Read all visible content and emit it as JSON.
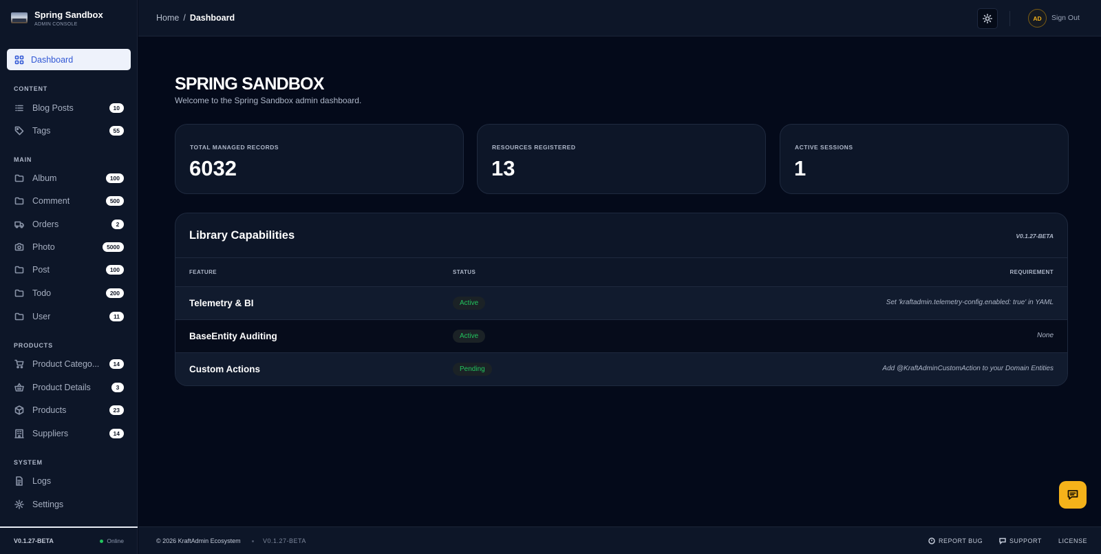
{
  "brand": {
    "title": "Spring Sandbox",
    "subtitle": "ADMIN CONSOLE"
  },
  "sidebar": {
    "active": {
      "label": "Dashboard",
      "icon": "dashboard-icon"
    },
    "sections": [
      {
        "title": "CONTENT",
        "items": [
          {
            "label": "Blog Posts",
            "count": "10",
            "icon": "list-icon"
          },
          {
            "label": "Tags",
            "count": "55",
            "icon": "tag-icon"
          }
        ]
      },
      {
        "title": "MAIN",
        "items": [
          {
            "label": "Album",
            "count": "100",
            "icon": "folder-icon"
          },
          {
            "label": "Comment",
            "count": "500",
            "icon": "folder-icon"
          },
          {
            "label": "Orders",
            "count": "2",
            "icon": "truck-icon"
          },
          {
            "label": "Photo",
            "count": "5000",
            "icon": "camera-icon"
          },
          {
            "label": "Post",
            "count": "100",
            "icon": "folder-icon"
          },
          {
            "label": "Todo",
            "count": "200",
            "icon": "folder-icon"
          },
          {
            "label": "User",
            "count": "11",
            "icon": "folder-icon"
          }
        ]
      },
      {
        "title": "PRODUCTS",
        "items": [
          {
            "label": "Product Catego...",
            "count": "14",
            "icon": "cart-icon"
          },
          {
            "label": "Product Details",
            "count": "3",
            "icon": "basket-icon"
          },
          {
            "label": "Products",
            "count": "23",
            "icon": "box-icon"
          },
          {
            "label": "Suppliers",
            "count": "14",
            "icon": "building-icon"
          }
        ]
      },
      {
        "title": "SYSTEM",
        "items": [
          {
            "label": "Logs",
            "icon": "file-icon"
          },
          {
            "label": "Settings",
            "icon": "gear-icon"
          }
        ]
      }
    ],
    "footer": {
      "version": "V0.1.27-BETA",
      "status": "Online"
    }
  },
  "header": {
    "breadcrumb": [
      "Home",
      "/",
      "Dashboard"
    ],
    "avatar_initials": "AD",
    "signout_label": "Sign Out"
  },
  "main": {
    "title": "SPRING SANDBOX",
    "subtitle": "Welcome to the Spring Sandbox admin dashboard.",
    "stats": [
      {
        "label": "TOTAL MANAGED RECORDS",
        "value": "6032"
      },
      {
        "label": "RESOURCES REGISTERED",
        "value": "13"
      },
      {
        "label": "ACTIVE SESSIONS",
        "value": "1"
      }
    ],
    "capabilities": {
      "title": "Library Capabilities",
      "version": "V0.1.27-BETA",
      "columns": [
        "FEATURE",
        "STATUS",
        "REQUIREMENT"
      ],
      "rows": [
        {
          "feature": "Telemetry & BI",
          "status": "Active",
          "requirement": "Set 'kraftadmin.telemetry-config.enabled: true' in YAML"
        },
        {
          "feature": "BaseEntity Auditing",
          "status": "Active",
          "requirement": "None"
        },
        {
          "feature": "Custom Actions",
          "status": "Pending",
          "requirement": "Add @KraftAdminCustomAction to your Domain Entities"
        }
      ]
    }
  },
  "footer": {
    "copyright": "© 2026 KraftAdmin Ecosystem",
    "version": "V0.1.27-BETA",
    "links": [
      "REPORT BUG",
      "SUPPORT",
      "LICENSE"
    ]
  },
  "colors": {
    "accent": "#3057d5",
    "fab": "#f5b21a",
    "status_green": "#22c55e",
    "background": "#040a1a",
    "panel": "#0d1628"
  }
}
